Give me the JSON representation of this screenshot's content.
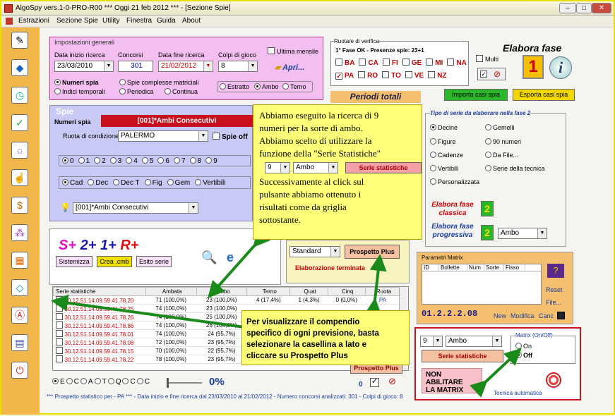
{
  "window": {
    "title": "AlgoSpy vers.1-0-PRO-R00  ***  Oggi 21 feb 2012  ***   - [Sezione Spie]"
  },
  "menu": [
    "Estrazioni",
    "Sezione Spie",
    "Utility",
    "Finestra",
    "Guida",
    "About"
  ],
  "impostazioni": {
    "title": "Impostazioni generali",
    "data_inizio_label": "Data inizio ricerca",
    "data_inizio": "23/03/2010",
    "concorsi_label": "Concorsi",
    "concorsi": "301",
    "data_fine_label": "Data fine ricerca",
    "data_fine": "21/02/2012",
    "colpi_label": "Colpi di gioco",
    "colpi": "8",
    "ultima_mensile": "Ultima mensile",
    "apri": "Apri...",
    "numeri_spia": "Numeri spia",
    "indici_temporali": "Indici temporali",
    "spie_complesse": "Spie complesse matriciali",
    "periodica": "Periodica",
    "continua": "Continua",
    "estratto": "Estratto",
    "ambo": "Ambo",
    "terno": "Terno"
  },
  "ruota": {
    "title": "Ruota/e di verifica",
    "fase": "1° Fase OK - Presenze spie: 23+1",
    "row1": [
      "BA",
      "CA",
      "FI",
      "GE",
      "MI",
      "NA"
    ],
    "row2": [
      "PA",
      "RO",
      "TO",
      "VE",
      "NZ"
    ],
    "multi": "Multi",
    "elabora_fase": "Elabora fase",
    "big_num": "1",
    "info": "i"
  },
  "periodi_totali": "Periodi totali",
  "importa": "Importa casi spia",
  "esporta": "Esporta casi spia",
  "spie": {
    "title": "Spie",
    "numeri_spia": "Numeri spia",
    "numeri_value": "[001]*Ambi Consecutivi",
    "ruota_label": "Ruota di condizione",
    "ruota_value": "PALERMO",
    "spie_off": "Spie off",
    "nums": [
      "0",
      "1",
      "2",
      "3",
      "4",
      "5",
      "6",
      "7",
      "8",
      "9"
    ],
    "modes": [
      "Cad",
      "Dec",
      "Dec T",
      "Fig",
      "Gem",
      "Vertibili"
    ],
    "bottom_value": "[001]*Ambi Consecutivi"
  },
  "tipo_serie": {
    "title": "Tipo di serie da elaborare nella fase 2",
    "left": [
      "Decine",
      "Figure",
      "Cadenze",
      "Vertibili",
      "Personalizzata"
    ],
    "right": [
      "Gemelli",
      "90 numeri",
      "Da File...",
      "Serie della tecnica"
    ],
    "elabora_classica": "Elabora fase classica",
    "elabora_progressiva": "Elabora fase progressiva",
    "two": "2",
    "ambo": "Ambo"
  },
  "sistema": {
    "logo_s": "S+",
    "logo_2": "2+",
    "logo_1": "1+",
    "logo_r": "R+",
    "sistemizza": "Sistemizza",
    "crea": "Crea .cmb",
    "esito": "Esito serie"
  },
  "prospetto": {
    "standard": "Standard",
    "prospetto_plus": "Prospetto Plus",
    "terminata": "Elaborazione terminata"
  },
  "matrix": {
    "title": "Parametri Matrix",
    "cols": [
      "ID",
      "Bollette",
      "Num",
      "Sorte",
      "Fisso"
    ],
    "reset": "Reset",
    "file": "File...",
    "code": "01.2.2.2.08",
    "new": "New",
    "modifica": "Modifica",
    "canc": "Canc"
  },
  "serie_box": {
    "num": "9",
    "sorte": "Ambo",
    "btn": "Serie statistiche",
    "matrix_title": "Matrix (On/Off)",
    "on": "On",
    "off": "Off",
    "tecnica": "Tecnica automatica"
  },
  "grid": {
    "headers": [
      "Serie statistiche",
      "Ambata",
      "Ambo",
      "Terno",
      "Quat",
      "Cinq",
      "Ruota"
    ],
    "rows": [
      [
        "30.12.51.14.09.59.41.78.20",
        "71 (100,0%)",
        "23 (100,0%)",
        "4 (17,4%)",
        "1 (4,3%)",
        "0 (0,0%)",
        "PA"
      ],
      [
        "30.12.51.14.09.59.41.78.25",
        "74 (100,0%)",
        "23 (100,0%)",
        "",
        "",
        "",
        ""
      ],
      [
        "30.12.51.14.09.59.41.78.26",
        "74 (100,0%)",
        "25 (100,0%)",
        "",
        "",
        "",
        ""
      ],
      [
        "30.12.51.14.09.59.41.78.86",
        "74 (100,0%)",
        "26 (100,0%)",
        "",
        "",
        "",
        ""
      ],
      [
        "30.12.51.14.09.59.41.78.01",
        "74 (100,0%)",
        "24 (95,7%)",
        "",
        "",
        "",
        ""
      ],
      [
        "30.12.51.14.09.59.41.78.08",
        "72 (100,0%)",
        "23 (95,7%)",
        "",
        "",
        "",
        ""
      ],
      [
        "30.12.51.14.09.59.41.78.15",
        "70 (100,0%)",
        "22 (95,7%)",
        "",
        "",
        "",
        ""
      ],
      [
        "30.12.51.14.09.59.41.78.22",
        "78 (100,0%)",
        "23 (95,7%)",
        "",
        "",
        "",
        ""
      ]
    ]
  },
  "bottom": {
    "opts": [
      "E",
      "C",
      "A",
      "T",
      "Q",
      "C",
      "C"
    ],
    "percent": "0%",
    "zero": "0",
    "prospetto_plus": "Prospetto Plus"
  },
  "status": "*** Prospetto statistico per  - PA ***  - Data inizio e fine ricerca dal 23/03/2010 al 21/02/2012 - Numero concorsi analizzati: 301 - Colpi di gioco: 8",
  "note1": {
    "l1": "Abbiamo eseguito la ricerca di 9",
    "l2": "numeri per la sorte di ambo.",
    "l3": "Abbiamo scelto di utilizzare la",
    "l4": "funzione della \"Serie Statistiche\"",
    "num": "9",
    "sorte": "Ambo",
    "btn": "Serie statistiche",
    "l5": "Successivamente al click sul",
    "l6": "pulsante abbiamo ottenuto i",
    "l7": "risultati come da griglia",
    "l8": "sottostante."
  },
  "note2": {
    "l1": "Per visualizzare il compendio",
    "l2": "specifico di ogni previsione, basta",
    "l3": "selezionare la casellina a lato e",
    "l4": "cliccare su Prospetto Plus"
  },
  "note3": {
    "l1": "NON ABILITARE",
    "l2": "LA MATRIX"
  }
}
